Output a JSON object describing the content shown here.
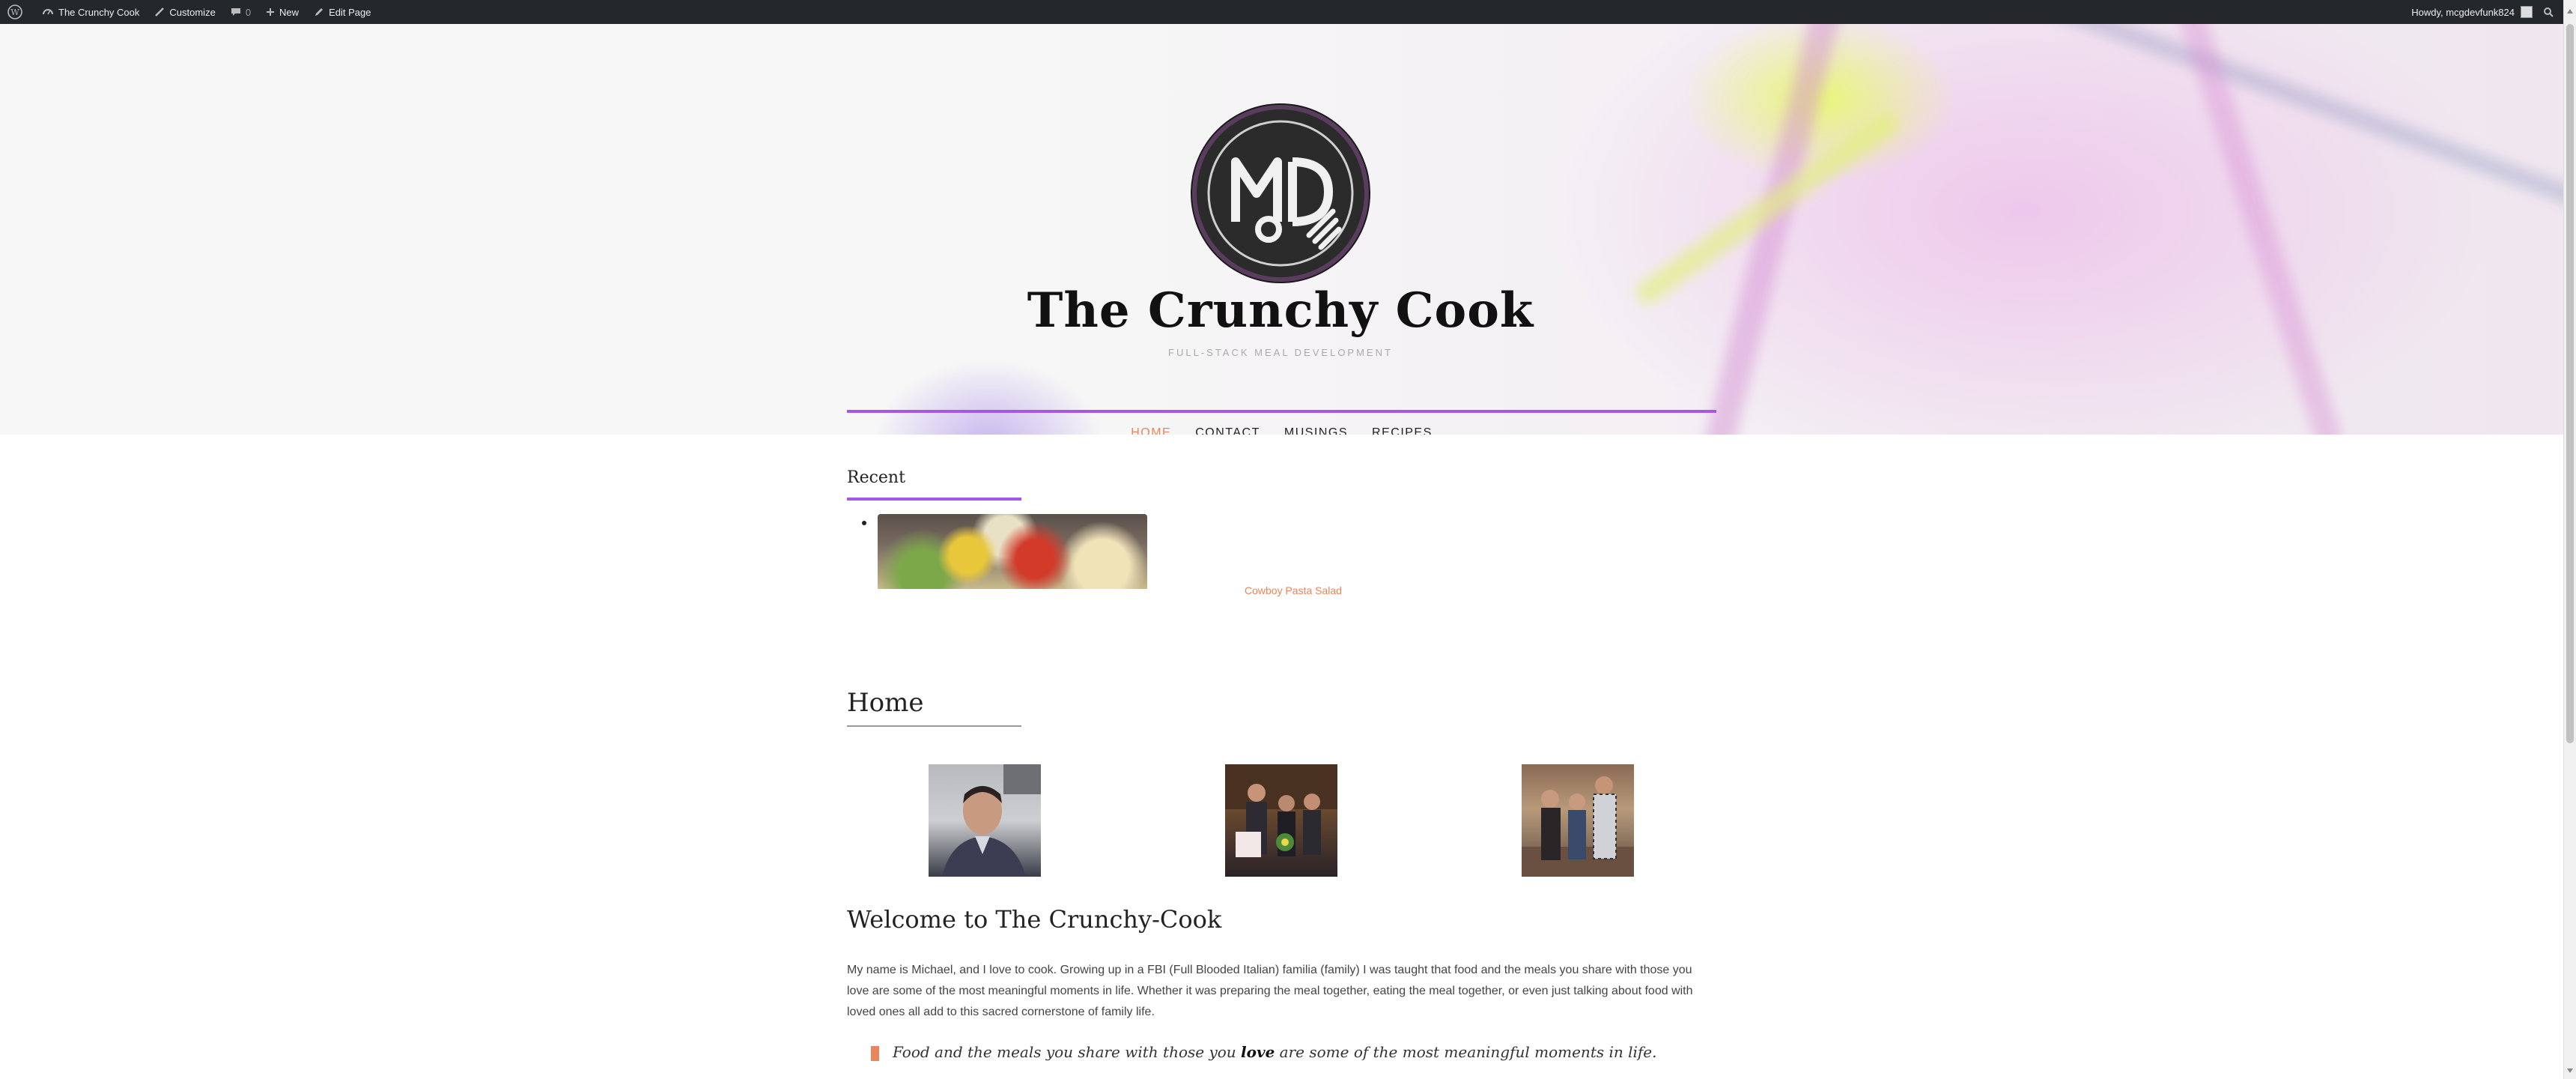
{
  "adminbar": {
    "site_name": "The Crunchy Cook",
    "customize": "Customize",
    "comments_count": "0",
    "new": "New",
    "edit_page": "Edit Page",
    "howdy": "Howdy, mcgdevfunk824"
  },
  "header": {
    "site_title": "The Crunchy Cook",
    "tagline": "FULL-STACK MEAL DEVELOPMENT",
    "accent_color": "#a259e6"
  },
  "nav": {
    "items": [
      {
        "label": "HOME",
        "current": true
      },
      {
        "label": "CONTACT"
      },
      {
        "label": "MUSINGS"
      },
      {
        "label": "RECIPES"
      }
    ],
    "active_color": "#e8855a"
  },
  "recent": {
    "title": "Recent",
    "post_link": "Cowboy Pasta Salad"
  },
  "page": {
    "title": "Home",
    "welcome_heading": "Welcome to The Crunchy-Cook",
    "intro": "My name is Michael, and I love to cook. Growing up in a FBI (Full Blooded Italian) familia (family) I was taught that food and the meals you share with those you love are some of the most meaningful moments in life. Whether it was preparing the meal together, eating the meal together, or even just talking about food with loved ones all add to this sacred cornerstone of family life.",
    "quote_before": "Food and the meals you share with those you ",
    "quote_bold": "love",
    "quote_after": " are some of the most meaningful moments in life."
  }
}
